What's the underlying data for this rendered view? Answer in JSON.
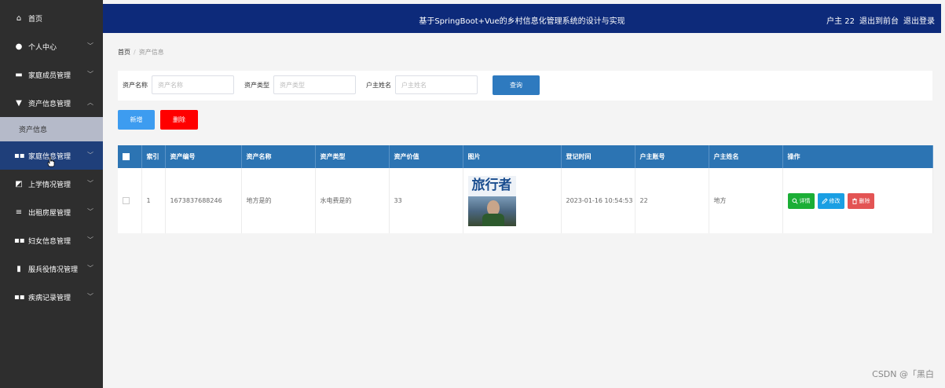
{
  "sidebar": {
    "items": [
      {
        "icon": "home-icon",
        "label": "首页",
        "arrow": false
      },
      {
        "icon": "user-icon",
        "label": "个人中心",
        "arrow": true
      },
      {
        "icon": "briefcase-icon",
        "label": "家庭成员管理",
        "arrow": true
      },
      {
        "icon": "asset-icon",
        "label": "资产信息管理",
        "arrow": true
      },
      {
        "icon": "grid-icon",
        "label": "家庭信息管理",
        "arrow": true
      },
      {
        "icon": "chart-icon",
        "label": "上学情况管理",
        "arrow": true
      },
      {
        "icon": "house-icon",
        "label": "出租房屋管理",
        "arrow": true
      },
      {
        "icon": "grid-icon",
        "label": "妇女信息管理",
        "arrow": true
      },
      {
        "icon": "bar-chart-icon",
        "label": "服兵役情况管理",
        "arrow": true
      },
      {
        "icon": "grid-icon",
        "label": "疾病记录管理",
        "arrow": true
      }
    ],
    "sub_item": "资产信息",
    "arrow_down": "﹀",
    "arrow_up": "︿"
  },
  "header": {
    "title": "基于SpringBoot+Vue的乡村信息化管理系统的设计与实现",
    "user": "户主 22",
    "to_front": "退出到前台",
    "logout": "退出登录"
  },
  "breadcrumb": {
    "home": "首页",
    "separator": "/",
    "current": "资产信息"
  },
  "search": {
    "asset_name_label": "资产名称",
    "asset_name_placeholder": "资产名称",
    "asset_type_label": "资产类型",
    "asset_type_placeholder": "资产类型",
    "owner_name_label": "户主姓名",
    "owner_name_placeholder": "户主姓名",
    "query_button": "查询"
  },
  "actions": {
    "add_button": "新增",
    "delete_button": "删除"
  },
  "table": {
    "columns": [
      "索引",
      "资产编号",
      "资产名称",
      "资产类型",
      "资产价值",
      "图片",
      "登记时间",
      "户主账号",
      "户主姓名",
      "操作"
    ],
    "rows": [
      {
        "index": "1",
        "asset_no": "1673837688246",
        "asset_name": "地方是的",
        "asset_type": "水电费是的",
        "asset_value": "33",
        "image_text": "旅行者",
        "register_time": "2023-01-16 10:54:53",
        "owner_account": "22",
        "owner_name": "地方"
      }
    ],
    "op_detail": "详情",
    "op_edit": "修改",
    "op_delete": "删除"
  },
  "watermark": "CSDN @「黑白"
}
